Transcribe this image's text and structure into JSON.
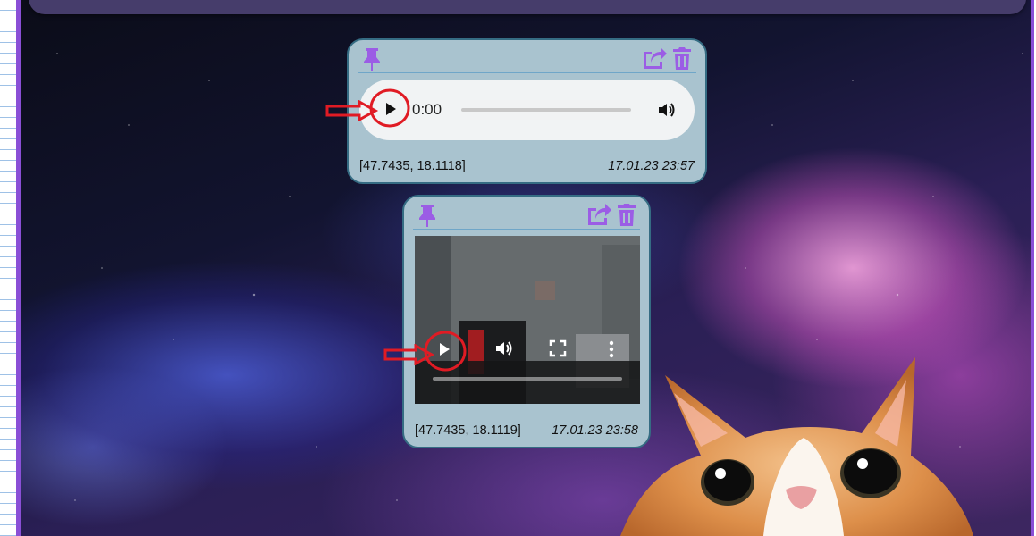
{
  "colors": {
    "card_bg": "#a9c3cf",
    "card_border": "#356c83",
    "icon_purple": "#9b5de5",
    "annotation_red": "#e01b24",
    "frame_purple": "#8a4fd6"
  },
  "icons": {
    "pin": "pin-icon",
    "share": "share-icon",
    "delete": "trash-icon",
    "play": "play-icon",
    "volume": "volume-icon",
    "fullscreen": "fullscreen-icon",
    "more": "more-vertical-icon"
  },
  "audio_card": {
    "player": {
      "current_time": "0:00",
      "progress": 0
    },
    "coords": "[47.7435, 18.1118]",
    "timestamp": "17.01.23 23:57"
  },
  "video_card": {
    "player": {
      "progress": 0
    },
    "coords": "[47.7435, 18.1119]",
    "timestamp": "17.01.23 23:58"
  }
}
